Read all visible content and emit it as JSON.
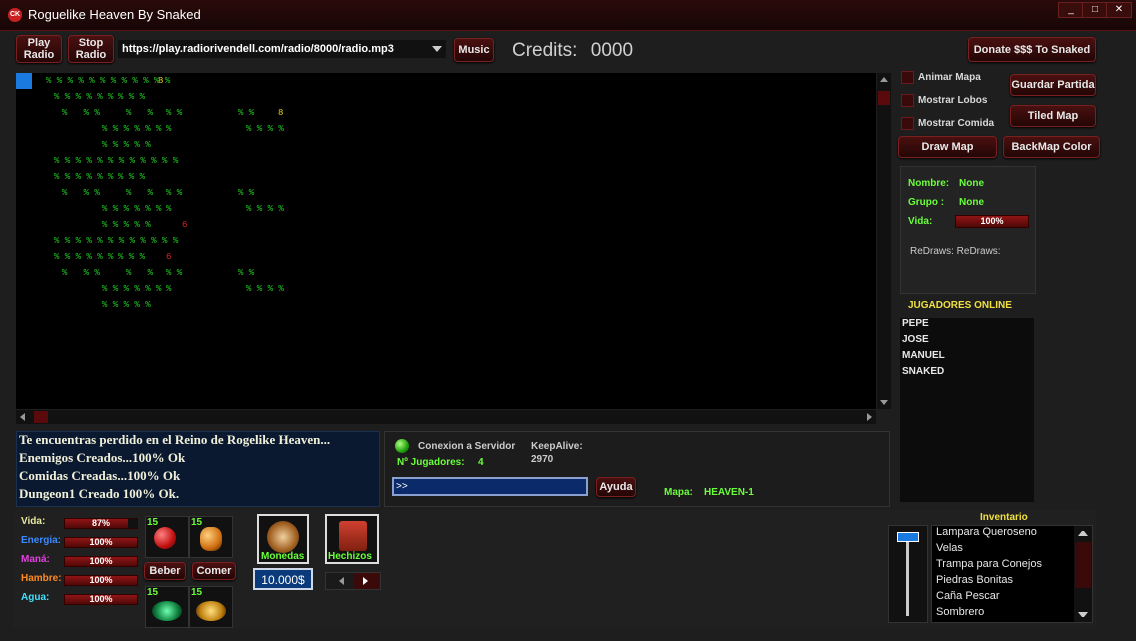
{
  "window": {
    "title": "Roguelike Heaven By Snaked",
    "icon_text": "CK",
    "min": "_",
    "max": "□",
    "close": "✕"
  },
  "toolbar": {
    "play_radio": "Play\nRadio",
    "stop_radio": "Stop\nRadio",
    "radio_url": "https://play.radiorivendell.com/radio/8000/radio.mp3",
    "music": "Music",
    "credits_label": "Credits:",
    "credits_value": "0000",
    "donate": "Donate $$$ To Snaked"
  },
  "map": {
    "rows": [
      {
        "cells": [
          {
            "t": "% % % % % % % % % % % %",
            "c": "g",
            "col": 1
          },
          {
            "t": "8",
            "c": "y",
            "col": 15
          }
        ]
      },
      {
        "cells": [
          {
            "t": "% % % % % %",
            "c": "g",
            "col": 2
          },
          {
            "t": "% % %",
            "c": "g",
            "col": 10
          }
        ]
      },
      {
        "cells": [
          {
            "t": "%   % %",
            "c": "g",
            "col": 3
          },
          {
            "t": "%   %",
            "c": "g",
            "col": 11
          },
          {
            "t": "% %",
            "c": "g",
            "col": 16
          },
          {
            "t": "% %",
            "c": "g",
            "col": 25
          },
          {
            "t": "8",
            "c": "y",
            "col": 30
          }
        ]
      },
      {
        "cells": [
          {
            "t": "% % % % % %",
            "c": "g",
            "col": 8
          },
          {
            "t": "%",
            "c": "g",
            "col": 16
          },
          {
            "t": "% % % %",
            "c": "g",
            "col": 26
          }
        ]
      },
      {
        "cells": [
          {
            "t": "% % % % %",
            "c": "g",
            "col": 8
          }
        ]
      },
      {
        "cells": [
          {
            "t": "% % % % % % % % % % % %",
            "c": "g",
            "col": 2
          }
        ]
      },
      {
        "cells": [
          {
            "t": "% % % % % %",
            "c": "g",
            "col": 2
          },
          {
            "t": "% % %",
            "c": "g",
            "col": 10
          }
        ]
      },
      {
        "cells": [
          {
            "t": "%   % %",
            "c": "g",
            "col": 3
          },
          {
            "t": "%   %",
            "c": "g",
            "col": 11
          },
          {
            "t": "% %",
            "c": "g",
            "col": 16
          },
          {
            "t": "% %",
            "c": "g",
            "col": 25
          }
        ]
      },
      {
        "cells": [
          {
            "t": "% % % % % %",
            "c": "g",
            "col": 8
          },
          {
            "t": "%",
            "c": "g",
            "col": 16
          },
          {
            "t": "% % % %",
            "c": "g",
            "col": 26
          }
        ]
      },
      {
        "cells": [
          {
            "t": "% % % % %",
            "c": "g",
            "col": 8
          },
          {
            "t": "6",
            "c": "r",
            "col": 18
          }
        ]
      },
      {
        "cells": [
          {
            "t": "% % % % % % % % % % % %",
            "c": "g",
            "col": 2
          }
        ]
      },
      {
        "cells": [
          {
            "t": "% % % % % %",
            "c": "g",
            "col": 2
          },
          {
            "t": "% % %",
            "c": "g",
            "col": 10
          },
          {
            "t": "6",
            "c": "r",
            "col": 16
          }
        ]
      },
      {
        "cells": [
          {
            "t": "%   % %",
            "c": "g",
            "col": 3
          },
          {
            "t": "%   %",
            "c": "g",
            "col": 11
          },
          {
            "t": "% %",
            "c": "g",
            "col": 16
          },
          {
            "t": "% %",
            "c": "g",
            "col": 25
          }
        ]
      },
      {
        "cells": [
          {
            "t": "% % % % % %",
            "c": "g",
            "col": 8
          },
          {
            "t": "%",
            "c": "g",
            "col": 16
          },
          {
            "t": "% % % %",
            "c": "g",
            "col": 26
          }
        ]
      },
      {
        "cells": [
          {
            "t": "% % % % %",
            "c": "g",
            "col": 8
          }
        ]
      }
    ]
  },
  "options": {
    "animar_mapa": "Animar Mapa",
    "mostrar_lobos": "Mostrar Lobos",
    "mostrar_comida": "Mostrar Comida",
    "guardar_partida": "Guardar Partida",
    "tiled_map": "Tiled Map",
    "draw_map": "Draw Map",
    "backmap_color": "BackMap Color"
  },
  "player_info": {
    "nombre_label": "Nombre:",
    "nombre_value": "None",
    "grupo_label": "Grupo :",
    "grupo_value": "None",
    "vida_label": "Vida:",
    "vida_value": "100%",
    "redraws": "ReDraws:  ReDraws:"
  },
  "online": {
    "header": "JUGADORES ONLINE",
    "players": [
      "PEPE",
      "JOSE",
      "MANUEL",
      "SNAKED"
    ]
  },
  "messages": [
    "Te encuentras perdido en el Reino de Rogelike Heaven...",
    "Enemigos Creados...100% Ok",
    "Comidas Creadas...100% Ok",
    "Dungeon1 Creado 100% Ok."
  ],
  "server": {
    "conexion": "Conexion a Servidor",
    "jugadores_label": "Nº Jugadores:",
    "jugadores_value": "4",
    "keepalive_label": "KeepAlive:",
    "keepalive_value": "2970",
    "command_value": ">>",
    "ayuda": "Ayuda",
    "mapa_label": "Mapa:",
    "mapa_value": "HEAVEN-1"
  },
  "stats": [
    {
      "label": "Vida:",
      "value": "87%",
      "level": 0.87,
      "color": "#e8e8a0"
    },
    {
      "label": "Energia:",
      "value": "100%",
      "level": 1.0,
      "color": "#3a8aff"
    },
    {
      "label": "Maná:",
      "value": "100%",
      "level": 1.0,
      "color": "#e040e0"
    },
    {
      "label": "Hambre:",
      "value": "100%",
      "level": 1.0,
      "color": "#ff8a20"
    },
    {
      "label": "Agua:",
      "value": "100%",
      "level": 1.0,
      "color": "#40e0ff"
    }
  ],
  "items": {
    "potion_red_qty": "15",
    "potion_orange_qty": "15",
    "herb_green_qty": "15",
    "food_yellow_qty": "15",
    "beber": "Beber",
    "comer": "Comer",
    "monedas": "Monedas",
    "hechizos": "Hechizos",
    "money": "10.000$"
  },
  "inventory": {
    "header": "Inventario",
    "items": [
      "Lampara Queroseno",
      "Velas",
      "Trampa para Conejos",
      "Piedras Bonitas",
      "Caña Pescar",
      "Sombrero"
    ]
  }
}
